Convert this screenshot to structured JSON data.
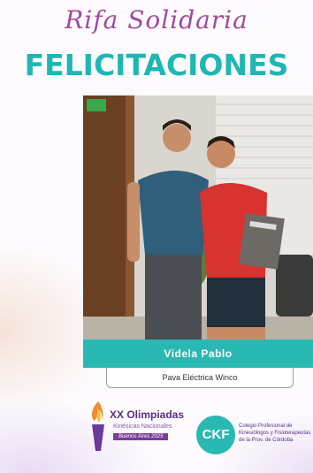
{
  "header": {
    "script_title": "Rifa Solidaria",
    "headline": "FELICITACIONES"
  },
  "winner": {
    "name": "Videla Pablo",
    "prize": "Pava Eléctrica Winco"
  },
  "sponsors": {
    "olimpiadas": {
      "title": "XX Olimpiadas",
      "subtitle": "Kinésicas Nacionales",
      "tag": "Buenos Aires 2025"
    },
    "colegio": {
      "logo_text": "CKF",
      "lines": [
        "Colegio Profesional de",
        "Kinesiólogos y Fisioterapeutas",
        "de la Prov. de Córdoba"
      ]
    }
  },
  "colors": {
    "accent_teal": "#2ab8b3",
    "script_purple": "#a24a9c"
  }
}
